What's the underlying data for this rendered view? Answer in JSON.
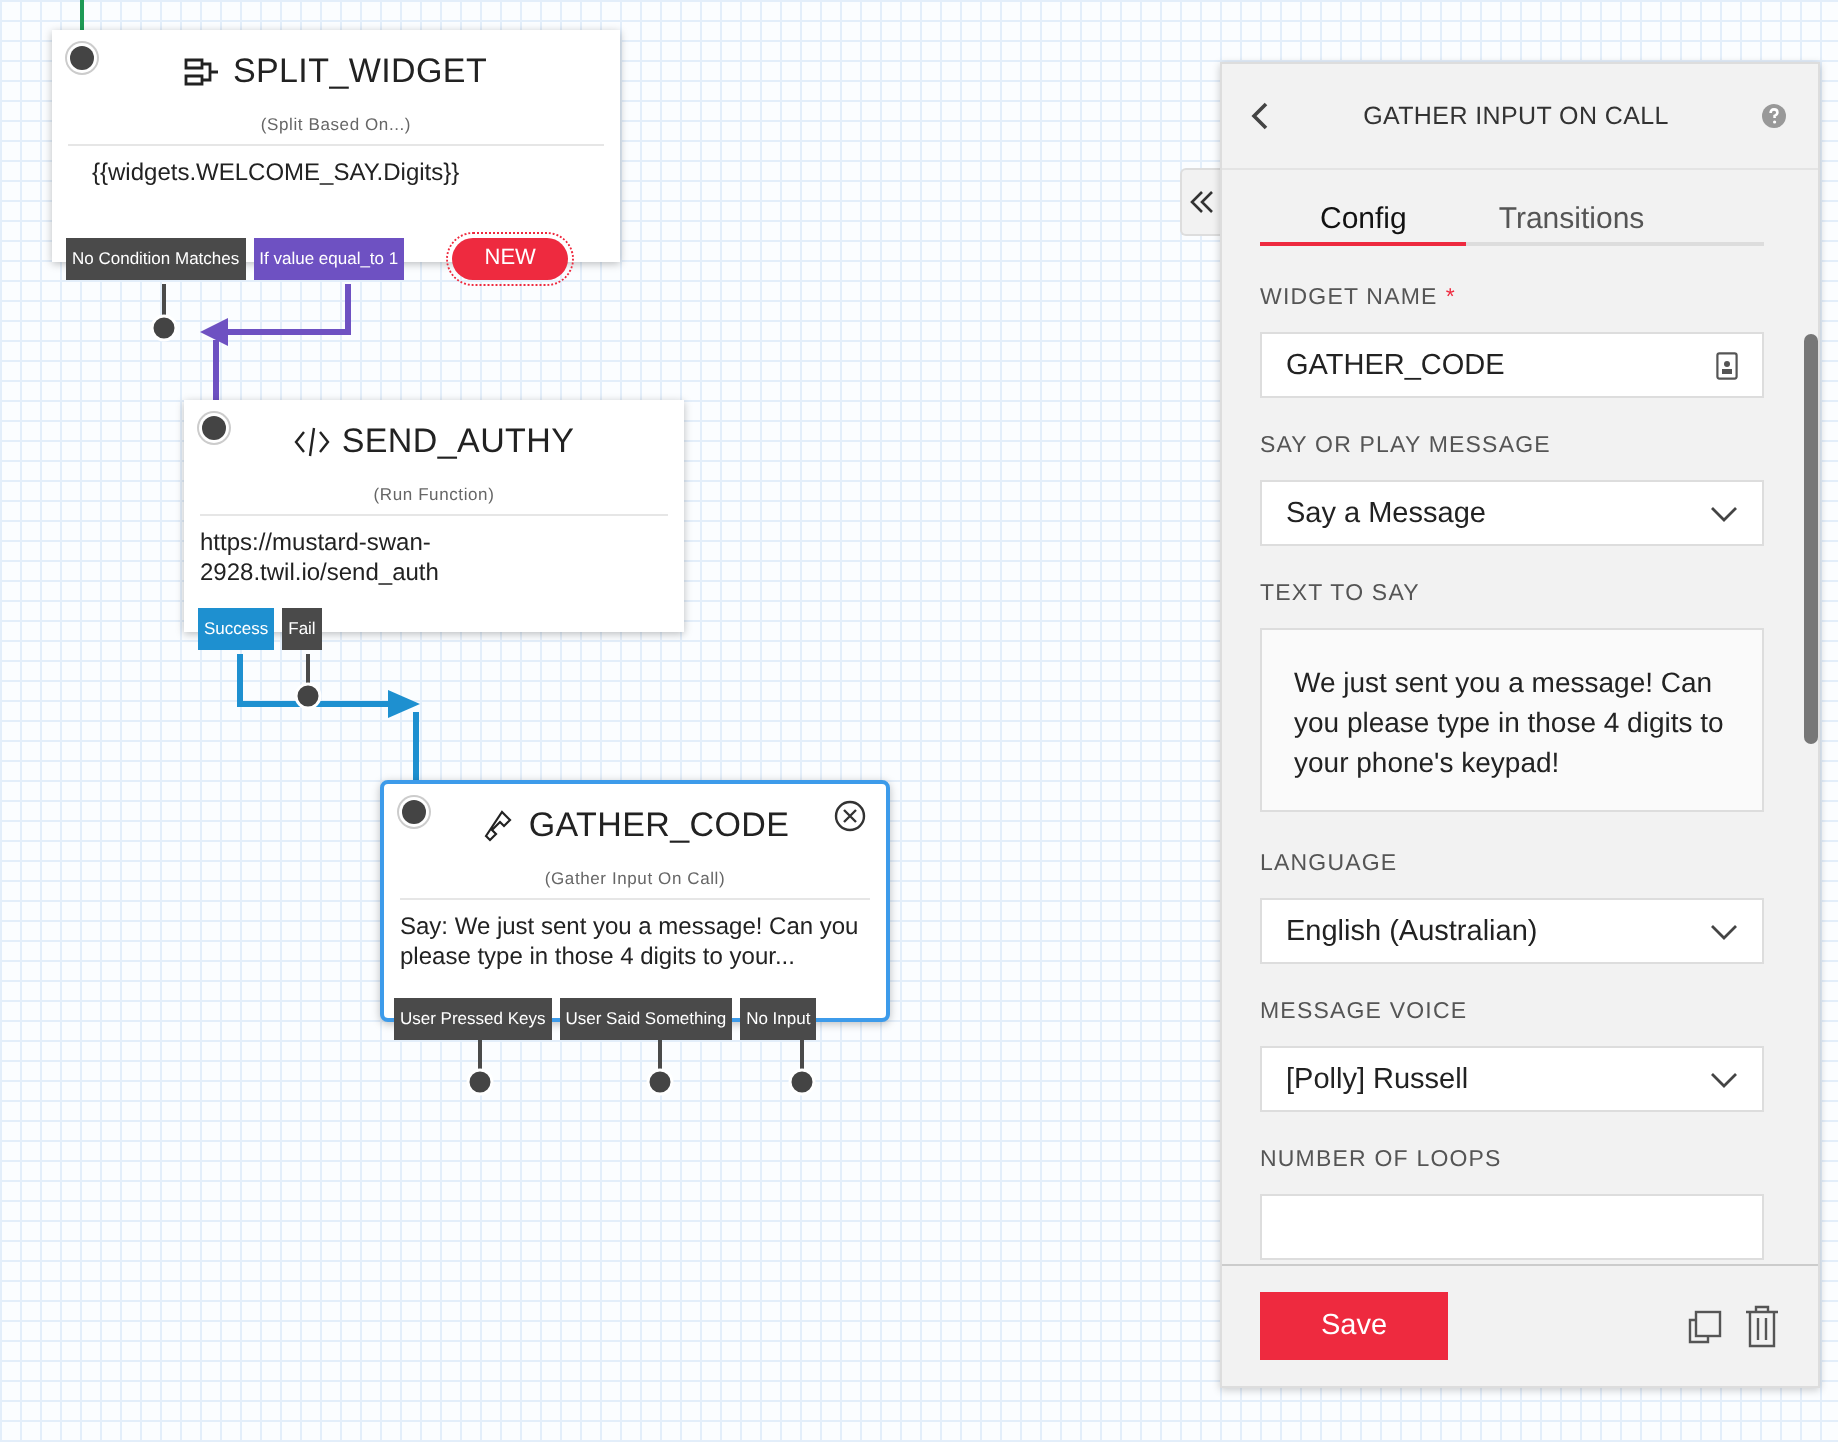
{
  "canvas": {
    "widgets": [
      {
        "kind": "split",
        "title": "SPLIT_WIDGET",
        "subtitle": "(Split Based On...)",
        "body": "{{widgets.WELCOME_SAY.Digits}}",
        "selected": false,
        "badge": "NEW",
        "transitions": [
          {
            "label": "No Condition Matches",
            "color": "#4a4a4a"
          },
          {
            "label": "If value equal_to 1",
            "color": "#6e51c2"
          }
        ]
      },
      {
        "kind": "function",
        "title": "SEND_AUTHY",
        "subtitle": "(Run Function)",
        "body": "https://mustard-swan-2928.twil.io/send_auth",
        "selected": false,
        "transitions": [
          {
            "label": "Success",
            "color": "#1e90d0"
          },
          {
            "label": "Fail",
            "color": "#4a4a4a"
          }
        ]
      },
      {
        "kind": "gather",
        "title": "GATHER_CODE",
        "subtitle": "(Gather Input On Call)",
        "body": "Say: We just sent you a message! Can you please type in those 4 digits to your...",
        "selected": true,
        "transitions": [
          {
            "label": "User Pressed Keys",
            "color": "#4a4a4a"
          },
          {
            "label": "User Said Something",
            "color": "#4a4a4a"
          },
          {
            "label": "No Input",
            "color": "#4a4a4a"
          }
        ]
      }
    ]
  },
  "panel": {
    "title": "GATHER INPUT ON CALL",
    "tabs": [
      {
        "label": "Config",
        "selected": true
      },
      {
        "label": "Transitions",
        "selected": false
      }
    ],
    "fields": [
      {
        "kind": "text",
        "label": "WIDGET NAME",
        "required_mark": "*",
        "value": "GATHER_CODE"
      },
      {
        "kind": "select",
        "label": "SAY OR PLAY MESSAGE",
        "value": "Say a Message"
      },
      {
        "kind": "textarea",
        "label": "TEXT TO SAY",
        "value": "We just sent you a message! Can you please type in those 4 digits to your phone's keypad!"
      },
      {
        "kind": "select",
        "label": "LANGUAGE",
        "value": "English (Australian)"
      },
      {
        "kind": "select",
        "label": "MESSAGE VOICE",
        "value": "[Polly] Russell"
      },
      {
        "kind": "text",
        "label": "NUMBER OF LOOPS"
      }
    ],
    "save_button": "Save"
  }
}
